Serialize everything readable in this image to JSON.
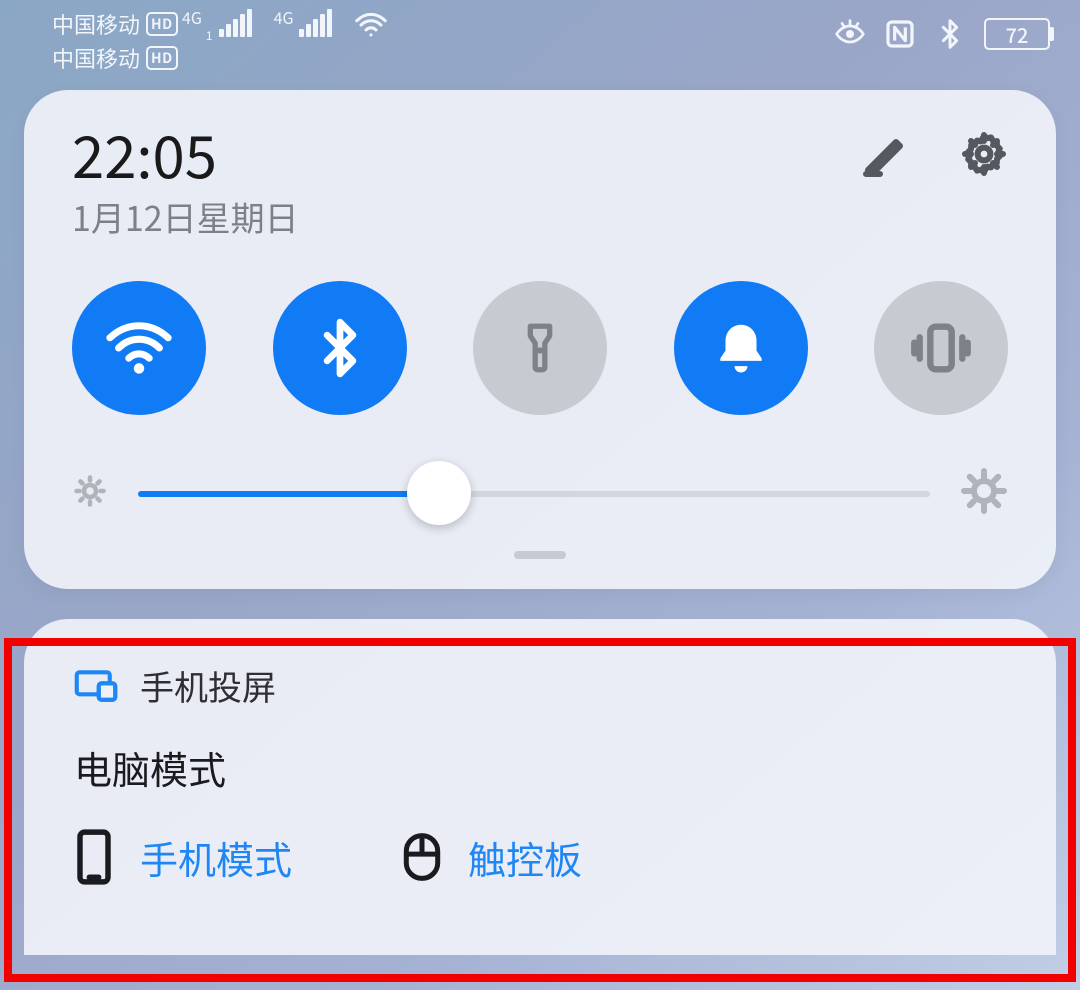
{
  "statusbar": {
    "carrier1": "中国移动",
    "carrier2": "中国移动",
    "hd": "HD",
    "net_label": "4G",
    "net_sub": "1",
    "battery": "72"
  },
  "qs": {
    "time": "22:05",
    "date": "1月12日星期日",
    "brightness_percent": 38,
    "toggles": [
      {
        "name": "wifi",
        "on": true
      },
      {
        "name": "bluetooth",
        "on": true
      },
      {
        "name": "flashlight",
        "on": false
      },
      {
        "name": "notifications",
        "on": true
      },
      {
        "name": "vibrate",
        "on": false
      }
    ]
  },
  "projection": {
    "header": "手机投屏",
    "mode": "电脑模式",
    "action_phone": "手机模式",
    "action_touchpad": "触控板"
  }
}
